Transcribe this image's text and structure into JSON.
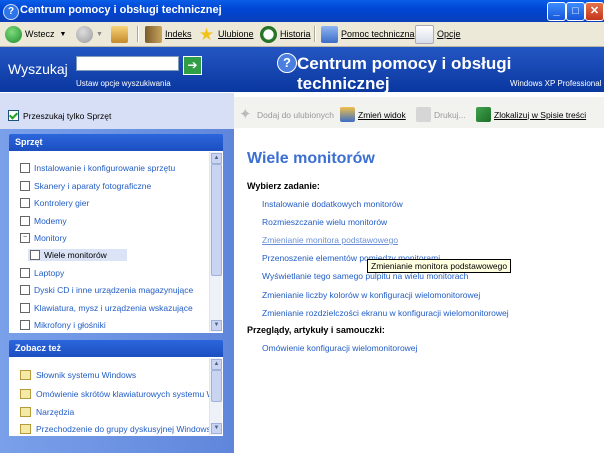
{
  "window": {
    "title": "Centrum pomocy i obsługi technicznej"
  },
  "toolbar": {
    "back": "Wstecz",
    "index": "Indeks",
    "favorites": "Ulubione",
    "history": "Historia",
    "support": "Pomoc techniczna",
    "options": "Opcje"
  },
  "search": {
    "label": "Wyszukaj",
    "value": "",
    "options_link": "Ustaw opcje wyszukiwania"
  },
  "header": {
    "title": "Centrum pomocy i obsługi technicznej",
    "edition": "Windows XP Professional"
  },
  "left": {
    "search_only": "Przeszukaj tylko Sprzęt",
    "hardware_title": "Sprzęt",
    "hardware_items": [
      "Instalowanie i konfigurowanie sprzętu",
      "Skanery i aparaty fotograficzne",
      "Kontrolery gier",
      "Modemy",
      "Monitory",
      "Wiele monitorów",
      "Laptopy",
      "Dyski CD i inne urządzenia magazynujące",
      "Klawiatura, mysz i urządzenia wskazujące",
      "Mikrofony i głośniki"
    ],
    "see_also_title": "Zobacz też",
    "see_also_items": [
      "Słownik systemu Windows",
      "Omówienie skrótów klawiaturowych systemu Win",
      "Narzędzia",
      "Przechodzenie do grupy dyskusyjnej Windows"
    ]
  },
  "right_toolbar": {
    "add_favorites": "Dodaj do ulubionych",
    "change_view": "Zmień widok",
    "print": "Drukuj...",
    "locate": "Zlokalizuj w Spisie treści"
  },
  "content": {
    "title": "Wiele monitorów",
    "task_heading": "Wybierz zadanie:",
    "tasks": [
      "Instalowanie dodatkowych monitorów",
      "Rozmieszczanie wielu monitorów",
      "Zmienianie monitora podstawowego",
      "Przenoszenie elementów pomiędzy monitorami",
      "Wyświetlanie tego samego pulpitu na wielu monitorach",
      "Zmienianie liczby kolorów w konfiguracji wielomonitorowej",
      "Zmienianie rozdzielczości ekranu w konfiguracji wielomonitorowej"
    ],
    "overview_heading": "Przeglądy, artykuły i samouczki:",
    "overview_links": [
      "Omówienie konfiguracji wielomonitorowej"
    ],
    "tooltip": "Zmienianie monitora podstawowego"
  }
}
